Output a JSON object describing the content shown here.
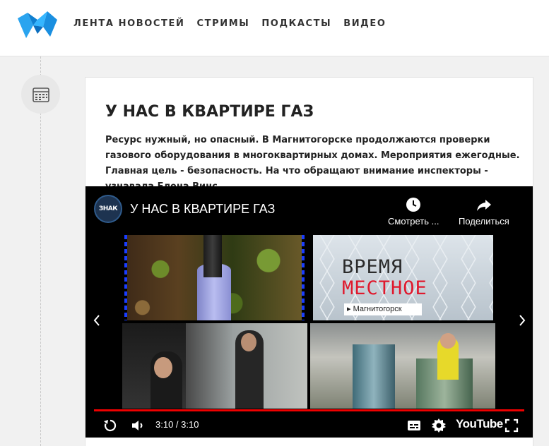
{
  "header": {
    "nav": [
      "ЛЕНТА НОВОСТЕЙ",
      "СТРИМЫ",
      "ПОДКАСТЫ",
      "ВИДЕО"
    ],
    "logo_color": "#1e9be4"
  },
  "article": {
    "title": "У НАС В КВАРТИРЕ ГАЗ",
    "lead": "Ресурс нужный, но опасный. В Магнитогорске продолжаются проверки газового оборудования в многоквартирных домах. Мероприятия ежегодные. Главная цель - безопасность. На что обращают внимание инспекторы - узнавала Елена Винс.",
    "date_icon": "calendar-icon"
  },
  "player": {
    "channel_logo_text": "ЗНАК",
    "title": "У НАС В КВАРТИРЕ ГАЗ",
    "watch_later": "Смотреть ...",
    "share": "Поделиться",
    "thumb_word1": "ВРЕМЯ",
    "thumb_word2": "МЕСТНОЕ",
    "thumb_city": "▸ Магнитогорск",
    "time": "3:10 / 3:10",
    "progress": 1.0,
    "brand": "YouTube"
  }
}
